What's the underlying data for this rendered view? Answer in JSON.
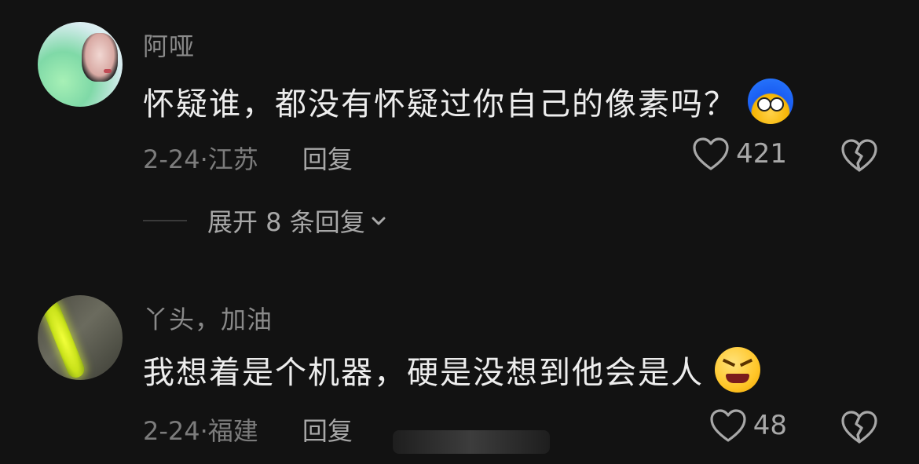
{
  "comments": [
    {
      "username": "阿哑",
      "text": "怀疑谁，都没有怀疑过你自己的像素吗？",
      "emoji": "blue-hair-sticker-icon",
      "date_location": "2-24·江苏",
      "reply_label": "回复",
      "likes": "421",
      "expand_label": "展开 8 条回复"
    },
    {
      "username": "丫头，加油",
      "text": "我想着是个机器，硬是没想到他会是人",
      "emoji": "angry-face-icon",
      "date_location": "2-24·福建",
      "reply_label": "回复",
      "likes": "48"
    }
  ],
  "colors": {
    "background": "#121212",
    "text": "#ededed",
    "muted": "#8a8a8a"
  }
}
